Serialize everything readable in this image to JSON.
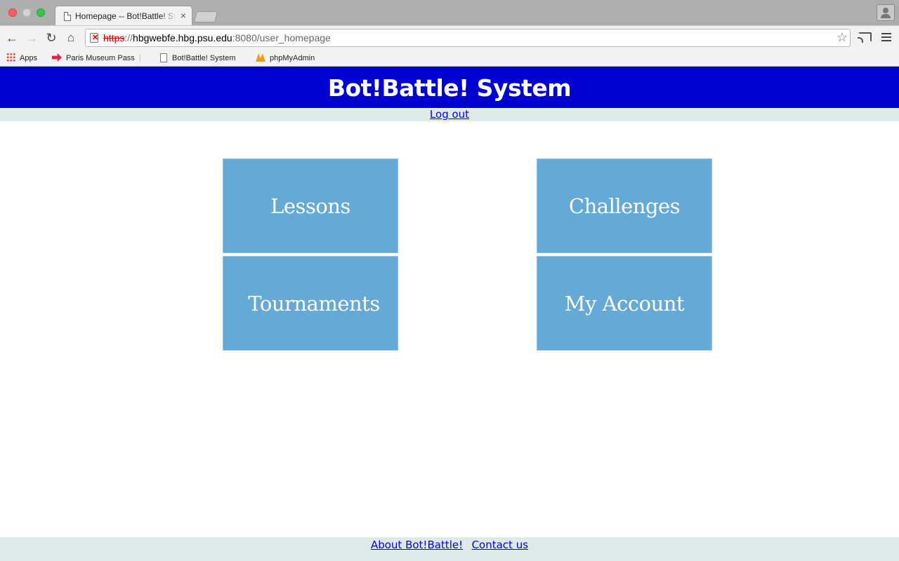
{
  "browser": {
    "tab_title": "Homepage -- Bot!Battle! System",
    "tab_close": "×",
    "url_scheme": "https",
    "url_separator": "://",
    "url_host": "hbgwebfe.hbg.psu.edu",
    "url_port_path": ":8080/user_homepage",
    "bookmarks": [
      {
        "label": "Apps"
      },
      {
        "label": "Paris Museum Pass"
      },
      {
        "label": "Bot!Battle! System"
      },
      {
        "label": "phpMyAdmin"
      }
    ]
  },
  "header": {
    "title": "Bot!Battle! System",
    "logout": "Log out",
    "background_color": "#0000d0"
  },
  "tiles": [
    {
      "label": "Lessons"
    },
    {
      "label": "Challenges"
    },
    {
      "label": "Tournaments"
    },
    {
      "label": "My Account"
    }
  ],
  "tile_color": "#65a9d6",
  "footer": {
    "about": "About Bot!Battle!",
    "contact": "Contact us"
  }
}
